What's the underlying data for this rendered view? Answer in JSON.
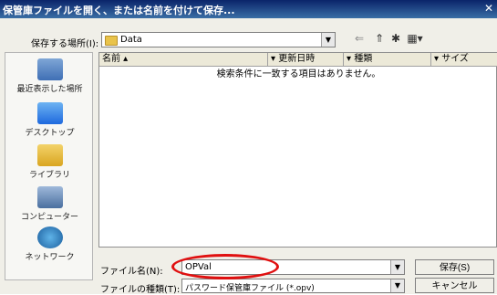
{
  "window": {
    "title": "保管庫ファイルを開く、または名前を付けて保存..."
  },
  "lookin": {
    "label": "保存する場所(I):",
    "value": "Data"
  },
  "toolbar": {
    "icons": [
      "back-icon",
      "up-folder-icon",
      "new-folder-icon",
      "view-menu-icon"
    ]
  },
  "places": [
    {
      "label": "最近表示した場所",
      "icon": "recent-places-icon"
    },
    {
      "label": "デスクトップ",
      "icon": "desktop-icon"
    },
    {
      "label": "ライブラリ",
      "icon": "libraries-icon"
    },
    {
      "label": "コンピューター",
      "icon": "computer-icon"
    },
    {
      "label": "ネットワーク",
      "icon": "network-icon"
    }
  ],
  "list": {
    "columns": [
      "名前",
      "更新日時",
      "種類",
      "サイズ"
    ],
    "empty_message": "検索条件に一致する項目はありません。"
  },
  "filename": {
    "label": "ファイル名(N):",
    "value": "OPVal"
  },
  "filetype": {
    "label": "ファイルの種類(T):",
    "value": "パスワード保管庫ファイル (*.opv)"
  },
  "buttons": {
    "save": "保存(S)",
    "cancel": "キャンセル"
  },
  "colors": {
    "titlebar": "#0a246a",
    "highlight": "#e01010"
  }
}
